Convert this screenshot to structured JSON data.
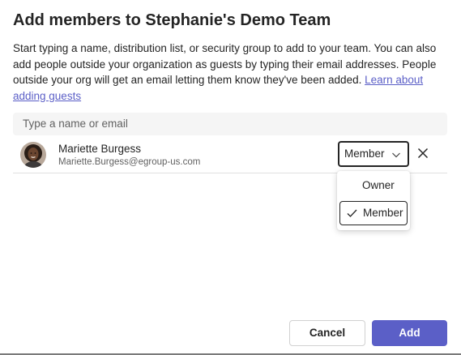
{
  "dialog": {
    "title": "Add members to Stephanie's Demo Team",
    "description_text": "Start typing a name, distribution list, or security group to add to your team. You can also add people outside your organization as guests by typing their email addresses. People outside your org will get an email letting them know they've been added. ",
    "learn_more_link": "Learn about adding guests"
  },
  "search": {
    "placeholder": "Type a name or email"
  },
  "member": {
    "name": "Mariette Burgess",
    "email": "Mariette.Burgess@egroup-us.com",
    "role": "Member",
    "avatar_icon": "person-photo"
  },
  "role_menu": {
    "options": [
      "Owner",
      "Member"
    ],
    "selected": "Member"
  },
  "actions": {
    "cancel_label": "Cancel",
    "add_label": "Add"
  },
  "colors": {
    "accent": "#5b5fc7",
    "text": "#242424",
    "muted": "#616161",
    "search_bg": "#f5f5f5"
  }
}
